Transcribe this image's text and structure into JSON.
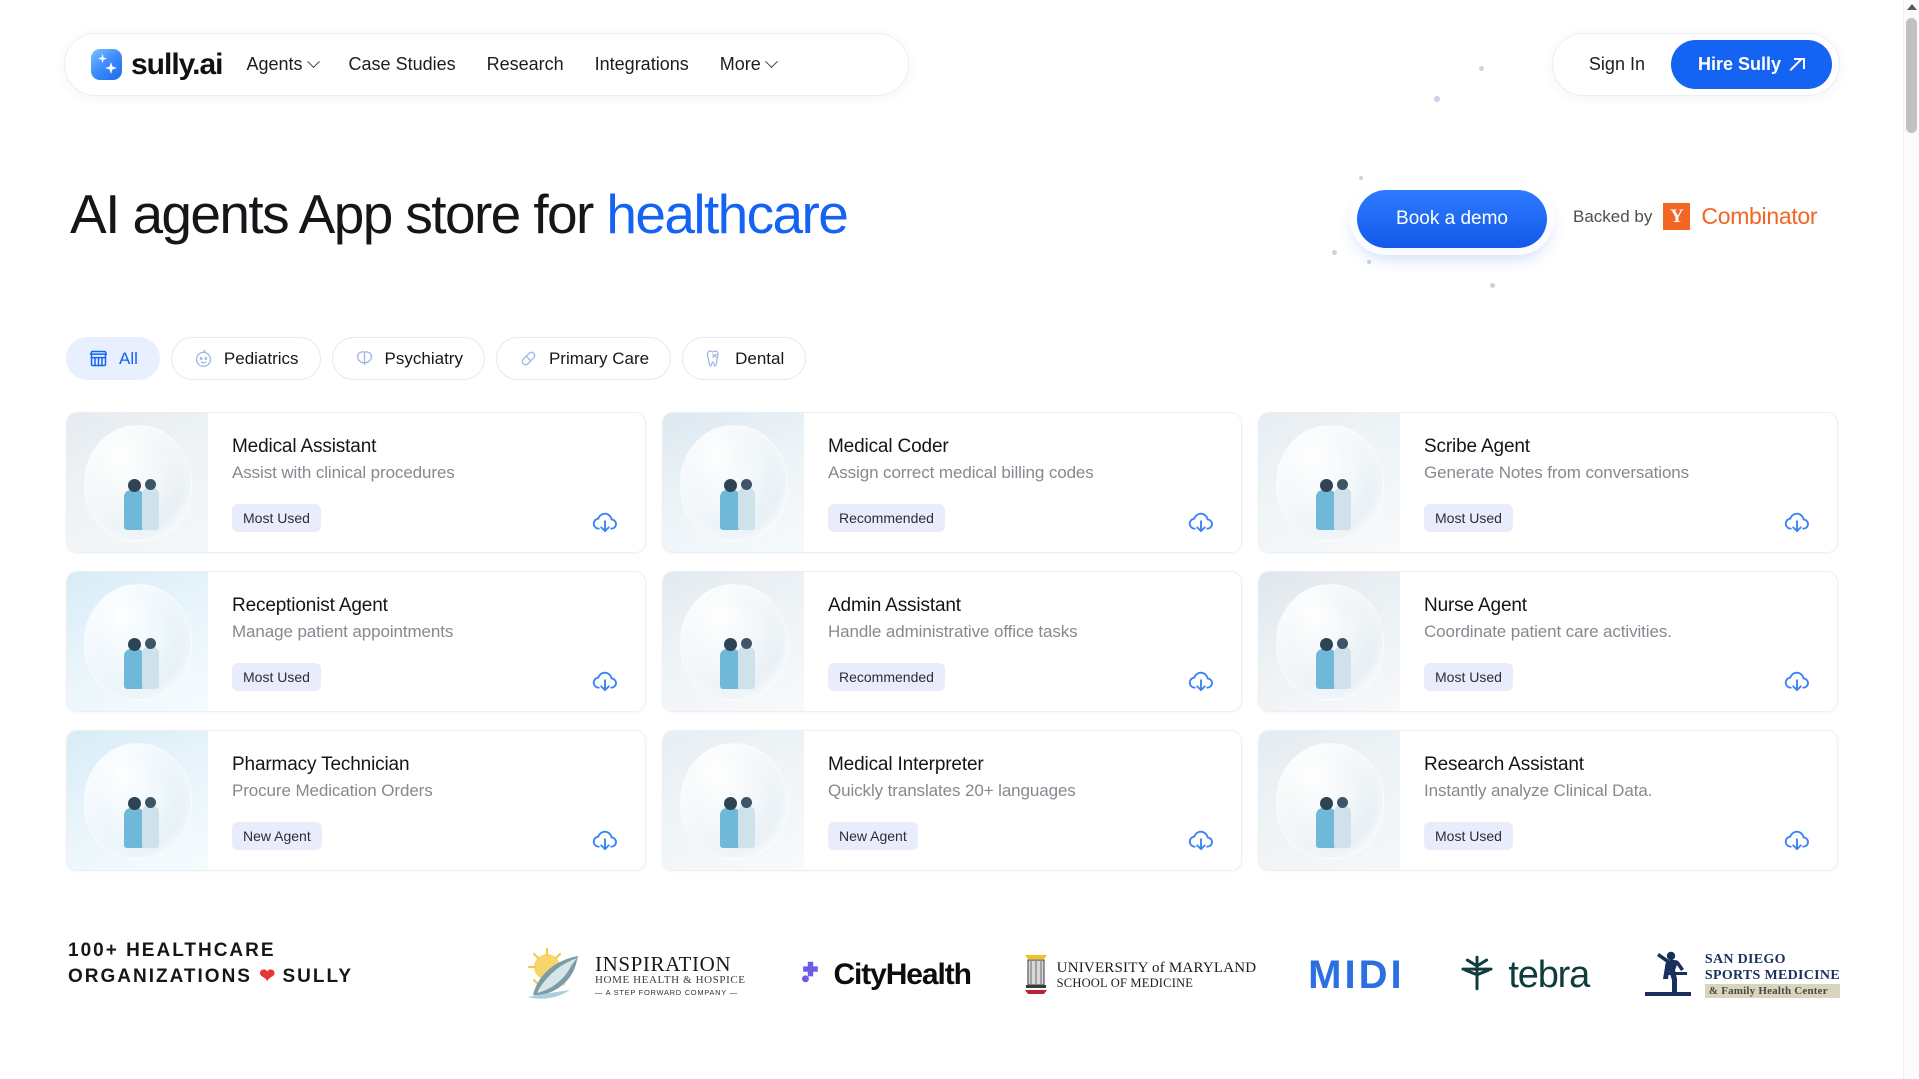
{
  "brand": {
    "name": "sully.ai",
    "logo_icon": "sully-sparkle-logo"
  },
  "nav": {
    "links": [
      {
        "label": "Agents",
        "has_dropdown": true
      },
      {
        "label": "Case Studies",
        "has_dropdown": false
      },
      {
        "label": "Research",
        "has_dropdown": false
      },
      {
        "label": "Integrations",
        "has_dropdown": false
      },
      {
        "label": "More",
        "has_dropdown": true
      }
    ],
    "sign_in": "Sign In",
    "hire_cta": "Hire Sully"
  },
  "hero": {
    "title_prefix": "AI agents App store for ",
    "title_highlight": "healthcare",
    "book_demo": "Book a demo",
    "backed_label": "Backed by",
    "yc_initial": "Y",
    "yc_name": "Combinator",
    "accent_color": "#1463f3",
    "yc_color": "#f26522"
  },
  "filters": [
    {
      "label": "All",
      "icon": "storefront-icon",
      "active": true
    },
    {
      "label": "Pediatrics",
      "icon": "baby-face-icon",
      "active": false
    },
    {
      "label": "Psychiatry",
      "icon": "brain-icon",
      "active": false
    },
    {
      "label": "Primary Care",
      "icon": "pill-capsule-icon",
      "active": false
    },
    {
      "label": "Dental",
      "icon": "tooth-icon",
      "active": false
    }
  ],
  "agents": [
    {
      "title": "Medical Assistant",
      "subtitle": "Assist with clinical procedures",
      "badge": "Most Used",
      "action_icon": "cloud-download-icon"
    },
    {
      "title": "Medical Coder",
      "subtitle": "Assign correct medical billing codes",
      "badge": "Recommended",
      "action_icon": "cloud-download-icon"
    },
    {
      "title": "Scribe Agent",
      "subtitle": "Generate Notes from conversations",
      "badge": "Most Used",
      "action_icon": "cloud-download-icon"
    },
    {
      "title": "Receptionist Agent",
      "subtitle": "Manage patient appointments",
      "badge": "Most Used",
      "action_icon": "cloud-download-icon"
    },
    {
      "title": "Admin Assistant",
      "subtitle": "Handle administrative office tasks",
      "badge": "Recommended",
      "action_icon": "cloud-download-icon"
    },
    {
      "title": "Nurse Agent",
      "subtitle": "Coordinate patient care activities.",
      "badge": "Most Used",
      "action_icon": "cloud-download-icon"
    },
    {
      "title": "Pharmacy Technician",
      "subtitle": "Procure Medication Orders",
      "badge": "New Agent",
      "action_icon": "cloud-download-icon"
    },
    {
      "title": "Medical Interpreter",
      "subtitle": "Quickly translates 20+ languages",
      "badge": "New Agent",
      "action_icon": "cloud-download-icon"
    },
    {
      "title": "Research Assistant",
      "subtitle": "Instantly analyze Clinical Data.",
      "badge": "Most Used",
      "action_icon": "cloud-download-icon"
    }
  ],
  "footer": {
    "orgs_line1": "100+ HEALTHCARE",
    "orgs_line2_prefix": "ORGANIZATIONS ",
    "orgs_heart": "❤",
    "orgs_line2_suffix": " SULLY",
    "logos": [
      {
        "name": "Inspiration Home Health & Hospice",
        "l1": "INSPIRATION",
        "l2": "HOME HEALTH & HOSPICE",
        "l3": "— A STEP FORWARD COMPANY —"
      },
      {
        "name": "CityHealth",
        "l1": "CityHealth"
      },
      {
        "name": "University of Maryland School of Medicine",
        "l1": "UNIVERSITY of MARYLAND",
        "l2": "SCHOOL OF MEDICINE"
      },
      {
        "name": "MIDI",
        "l1": "MIDI"
      },
      {
        "name": "Tebra",
        "l1": "tebra"
      },
      {
        "name": "San Diego Sports Medicine & Family Health Center",
        "l1": "SAN DIEGO",
        "l2": "SPORTS MEDICINE",
        "l3": "& Family Health Center"
      }
    ]
  }
}
